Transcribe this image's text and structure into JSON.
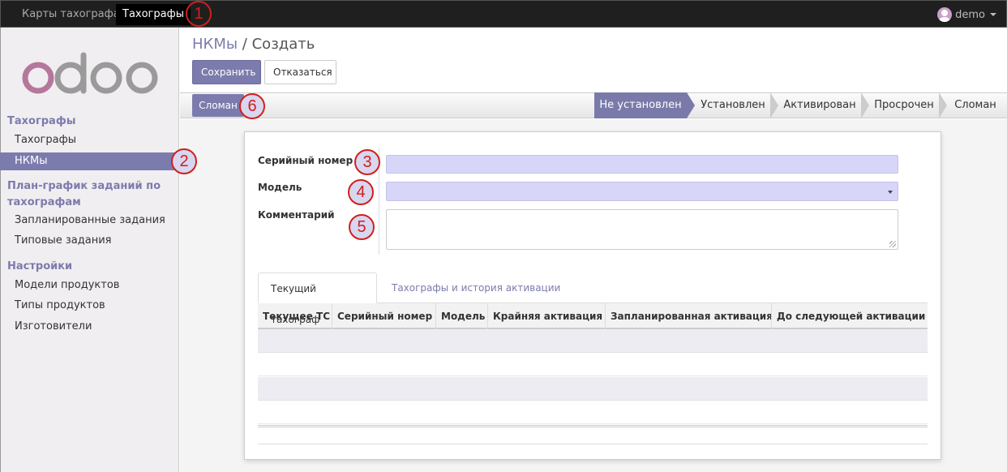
{
  "topbar": {
    "menu": [
      "Карты тахографа",
      "Тахографы"
    ],
    "active_index": 1,
    "user": "demo"
  },
  "callouts": [
    "1",
    "2",
    "3",
    "4",
    "5",
    "6"
  ],
  "sidebar": {
    "logo_text": "odoo",
    "sections": [
      {
        "title": "Тахографы",
        "items": [
          "Тахографы",
          "НКМы"
        ]
      },
      {
        "title_lines": [
          "План-график заданий по",
          "тахографам"
        ],
        "items": [
          "Запланированные задания",
          "Типовые задания"
        ]
      },
      {
        "title": "Настройки",
        "items": [
          "Модели продуктов",
          "Типы продуктов",
          "Изготовители"
        ]
      }
    ],
    "active_item": "НКМы"
  },
  "breadcrumb": {
    "parent": "НКМы",
    "separator": "/",
    "current": "Создать"
  },
  "buttons": {
    "save": "Сохранить",
    "discard": "Отказаться",
    "broken": "Сломан"
  },
  "stages": [
    "Не установлен",
    "Установлен",
    "Активирован",
    "Просрочен",
    "Сломан"
  ],
  "active_stage": "Не установлен",
  "form": {
    "serial_label": "Серийный номер",
    "serial_value": "",
    "model_label": "Модель",
    "model_value": "",
    "comment_label": "Комментарий",
    "comment_value": ""
  },
  "tabs": [
    "Текущий тахограф",
    "Тахографы и история активации"
  ],
  "table": {
    "columns": [
      "Текущее ТС",
      "Серийный номер",
      "Модель",
      "Крайняя активация",
      "Запланированная активация",
      "До следующей активации"
    ],
    "rows": []
  },
  "colors": {
    "accent": "#7c7bad",
    "required_field": "#d8d6f8",
    "callout": "#d0201a"
  }
}
